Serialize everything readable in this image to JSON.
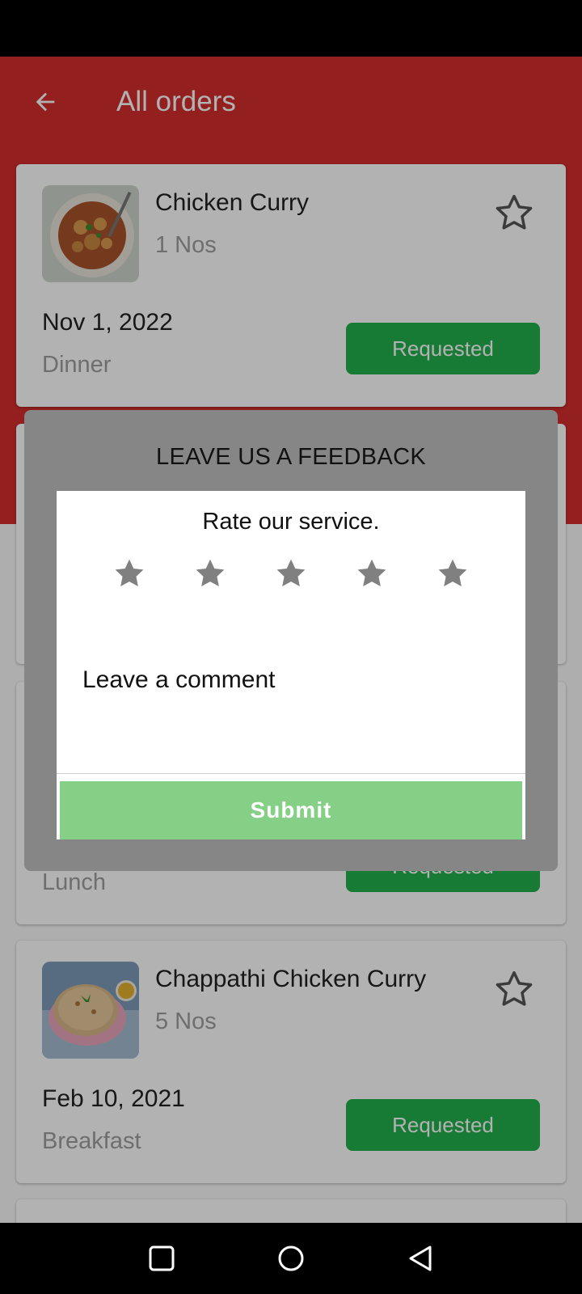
{
  "app_bar": {
    "title": "All orders",
    "back_icon": "arrow-left-icon"
  },
  "orders": [
    {
      "name": "Chicken Curry",
      "qty": "1 Nos",
      "date": "Nov 1, 2022",
      "meal": "Dinner",
      "status": "Requested",
      "favorite_icon": "star-outline-icon"
    },
    {
      "meal": "Lunch",
      "status": "Requested"
    },
    {
      "name": "Chappathi Chicken Curry",
      "qty": "5 Nos",
      "date": "Feb 10, 2021",
      "meal": "Breakfast",
      "status": "Requested",
      "favorite_icon": "star-outline-icon"
    }
  ],
  "feedback_dialog": {
    "title": "LEAVE US A FEEDBACK",
    "rate_prompt": "Rate our service.",
    "rating": {
      "max": 5,
      "selected": 0
    },
    "comment_placeholder": "Leave a comment",
    "submit_label": "Submit"
  },
  "colors": {
    "app_bar": "#d32d2d",
    "status_button": "#22b14c",
    "submit_button": "#86cf86",
    "dialog_background": "#868686"
  },
  "nav_bar": {
    "icons": [
      "square-icon",
      "circle-icon",
      "triangle-back-icon"
    ]
  }
}
